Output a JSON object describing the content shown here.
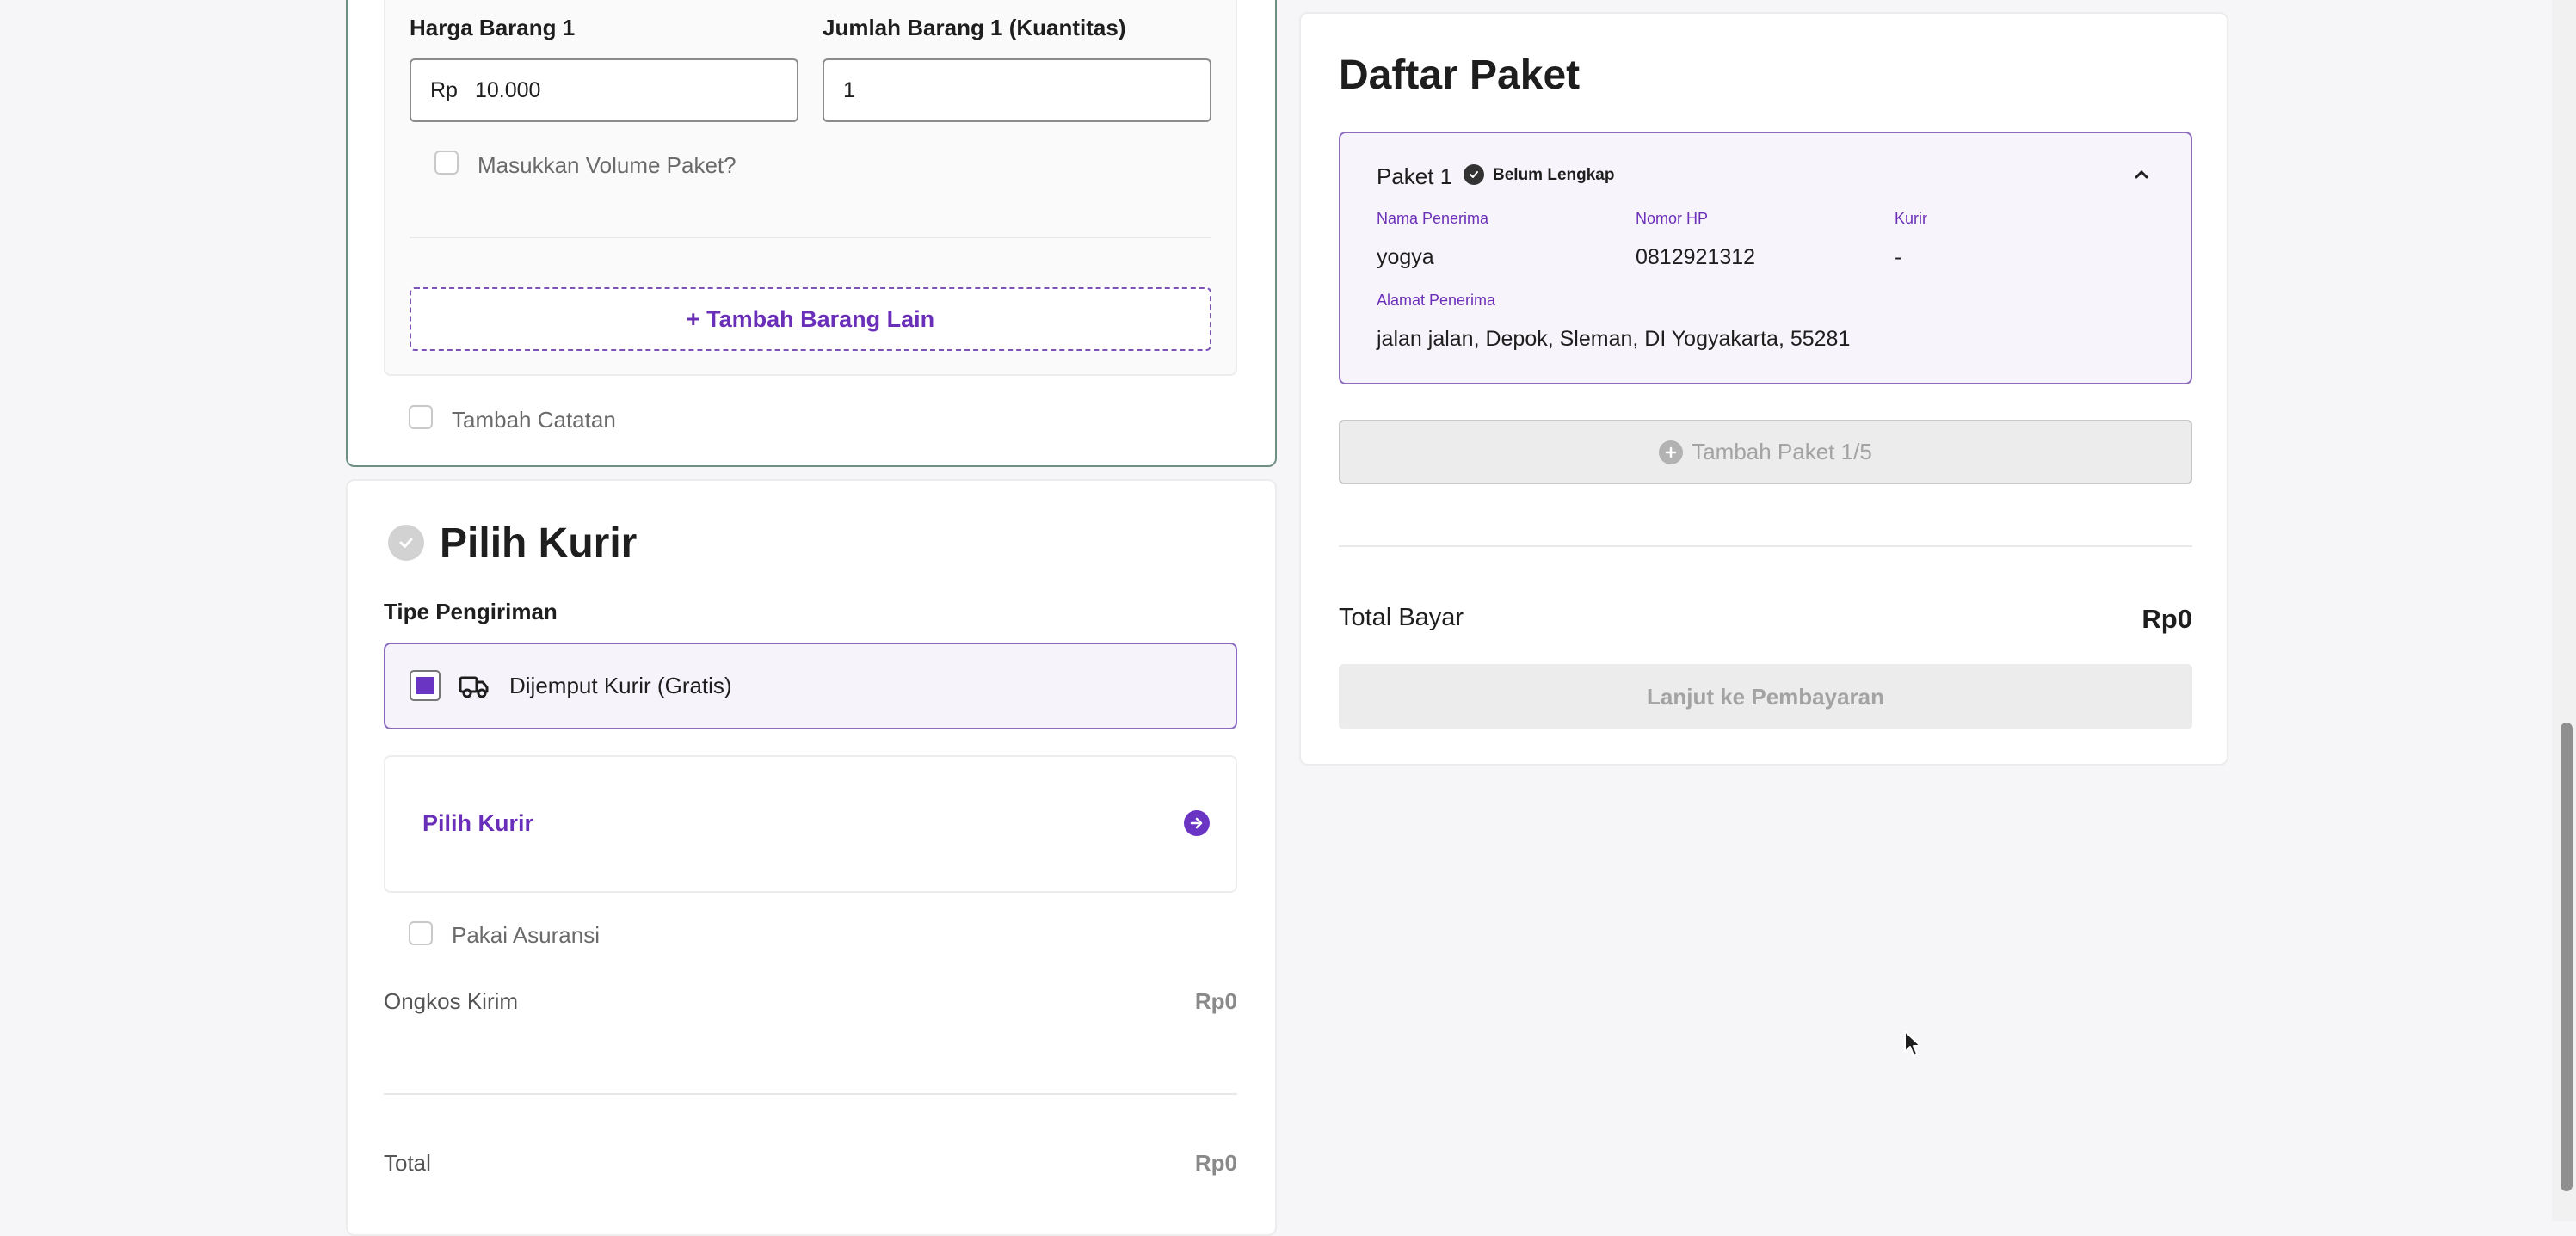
{
  "items": {
    "price_label": "Harga Barang 1",
    "price_prefix": "Rp",
    "price_value": "10.000",
    "qty_label": "Jumlah Barang 1 (Kuantitas)",
    "qty_value": "1",
    "volume_checkbox_label": "Masukkan Volume Paket?",
    "add_item_button": "+ Tambah Barang Lain",
    "note_checkbox_label": "Tambah Catatan"
  },
  "courier": {
    "title": "Pilih Kurir",
    "shipping_type_label": "Tipe Pengiriman",
    "shipping_option": "Dijemput Kurir (Gratis)",
    "pick_courier_label": "Pilih Kurir",
    "insurance_label": "Pakai Asuransi",
    "shipping_cost_label": "Ongkos Kirim",
    "shipping_cost_value": "Rp0",
    "total_label": "Total",
    "total_value": "Rp0"
  },
  "packages": {
    "title": "Daftar Paket",
    "package_name": "Paket 1",
    "status": "Belum Lengkap",
    "recipient_label": "Nama Penerima",
    "recipient_value": "yogya",
    "phone_label": "Nomor HP",
    "phone_value": "0812921312",
    "courier_label": "Kurir",
    "courier_value": "-",
    "address_label": "Alamat Penerima",
    "address_value": "jalan jalan, Depok, Sleman, DI Yogyakarta, 55281",
    "add_package_button": "Tambah Paket 1/5",
    "total_pay_label": "Total Bayar",
    "total_pay_value": "Rp0",
    "pay_button": "Lanjut ke Pembayaran"
  },
  "colors": {
    "accent": "#6b35c4",
    "accent_border": "#8a6bc0",
    "item_panel_border": "#6f8f83"
  }
}
